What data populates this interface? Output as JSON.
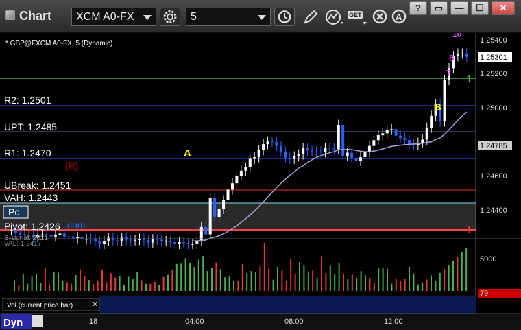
{
  "window": {
    "title": "Chart",
    "symbol": "XCM A0-FX",
    "interval": "5",
    "buttons": {
      "help": "?",
      "restore": "▭",
      "minimize": "—",
      "maximize": "☐",
      "close": "✕"
    }
  },
  "chart_header": "* GBP@FXCM A0-FX, 5 (Dynamic)",
  "price_axis": {
    "ticks": [
      "1.25400",
      "1.25200",
      "1.25000",
      "1.24600",
      "1.24400"
    ],
    "last_price": "1.25301",
    "secondary_price": "1.24785"
  },
  "levels": [
    {
      "label": "R2: 1.2501",
      "color": "#3d5afe"
    },
    {
      "label": "UPT: 1.2485",
      "color": "#5c6bc0"
    },
    {
      "label": "R1: 1.2470",
      "color": "#3d5afe"
    },
    {
      "label": "UBreak: 1.2451",
      "color": "#e53935"
    },
    {
      "label": "VAH: 1.2443",
      "color": "#80deea"
    },
    {
      "label": "Pivot: 1.2426",
      "color": "#ff4444"
    }
  ],
  "annotations": {
    "r_marker": "(R)",
    "a_marker": "A",
    "b_marker": "B",
    "seq_top": "10",
    "seq_8": "8",
    "seq_7": "7",
    "green_one": "1",
    "red_one": "1",
    "po_tag": "Pc",
    "com_tag": "com",
    "obscured_text": "S-signal: 2021",
    "val_text": "VAL: 1.2417"
  },
  "volume": {
    "label": "Vol (current price bar)",
    "ticks": [
      "5000"
    ],
    "current": "79"
  },
  "time_axis": {
    "labels": [
      "18",
      "04:00",
      "08:00",
      "12:00"
    ],
    "workspace_tab": "Dyn"
  },
  "colors": {
    "price_up": "#ffffff",
    "price_down": "#2962ff",
    "vol_up": "#4caf50",
    "vol_down": "#e53935",
    "ma_line": "#b39ddb",
    "magenta": "#e040fb",
    "yellow": "#ffff00",
    "green": "#4caf50"
  }
}
